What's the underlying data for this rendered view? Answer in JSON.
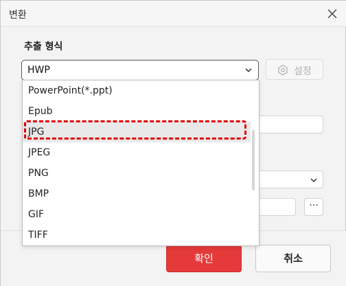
{
  "window": {
    "title": "변환",
    "close_icon": "close-icon"
  },
  "section": {
    "label": "추출 형식"
  },
  "format_select": {
    "value": "HWP"
  },
  "settings_button": {
    "label": "설정",
    "icon": "gear-icon"
  },
  "dropdown": {
    "items": [
      "PowerPoint(*.ppt)",
      "Epub",
      "JPG",
      "JPEG",
      "PNG",
      "BMP",
      "GIF",
      "TIFF"
    ],
    "highlighted": "JPG"
  },
  "more_button": {
    "label": "···"
  },
  "footer": {
    "ok_label": "확인",
    "cancel_label": "취소"
  },
  "colors": {
    "accent": "#e53a3a",
    "highlight": "#e00000"
  }
}
